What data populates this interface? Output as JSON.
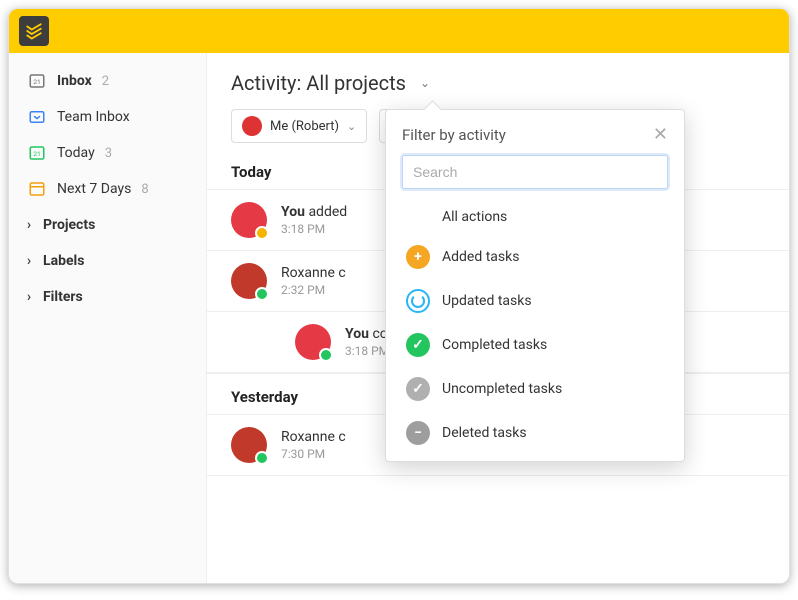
{
  "sidebar": {
    "inbox": {
      "label": "Inbox",
      "count": "2"
    },
    "teamInbox": {
      "label": "Team Inbox"
    },
    "today": {
      "label": "Today",
      "count": "3",
      "dayNumber": "21"
    },
    "next7": {
      "label": "Next 7 Days",
      "count": "8"
    },
    "projects": {
      "label": "Projects"
    },
    "labels": {
      "label": "Labels"
    },
    "filters": {
      "label": "Filters"
    }
  },
  "header": {
    "title": "Activity: All projects"
  },
  "filterBar": {
    "userDropdown": {
      "label": "Me (Robert)"
    },
    "actionDropdown": {
      "label": "All actions"
    }
  },
  "sections": [
    {
      "heading": "Today",
      "items": [
        {
          "who": "You",
          "rest": " added",
          "time": "3:18 PM",
          "badge": "yellow",
          "avatarClass": ""
        },
        {
          "who": "",
          "rest": "Roxanne c",
          "time": "2:32 PM",
          "badge": "green",
          "avatarClass": "r2"
        },
        {
          "who": "You",
          "rest": " co",
          "time": "3:18 PM",
          "badge": "green",
          "avatarClass": "",
          "indent": true
        }
      ]
    },
    {
      "heading": "Yesterday",
      "items": [
        {
          "who": "",
          "rest": "Roxanne c",
          "time": "7:30 PM",
          "badge": "green",
          "avatarClass": "r2"
        }
      ]
    }
  ],
  "popup": {
    "title": "Filter by activity",
    "searchPlaceholder": "Search",
    "options": {
      "all": "All actions",
      "added": "Added tasks",
      "updated": "Updated tasks",
      "completed": "Completed tasks",
      "uncompleted": "Uncompleted tasks",
      "deleted": "Deleted tasks"
    }
  },
  "glyphs": {
    "plus": "+",
    "check": "✓",
    "minus": "−",
    "times": "✕",
    "chevronDown": "⌄",
    "chevronRight": "›",
    "calendarDay": "21"
  }
}
